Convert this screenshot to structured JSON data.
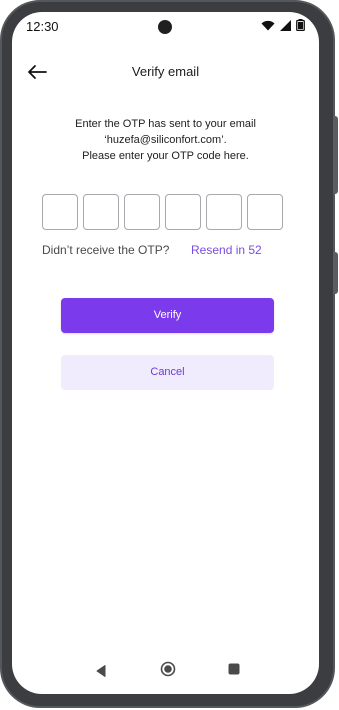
{
  "status_bar": {
    "time": "12:30"
  },
  "header": {
    "title": "Verify email"
  },
  "description": {
    "line1": "Enter the OTP has sent to your email",
    "line2": "‘huzefa@siliconfort.com’.",
    "line3": "Please enter your OTP code here."
  },
  "otp": {
    "digits": [
      "",
      "",
      "",
      "",
      "",
      ""
    ]
  },
  "resend": {
    "question": "Didn’t receive the OTP?",
    "action": "Resend in 52"
  },
  "buttons": {
    "verify": "Verify",
    "cancel": "Cancel"
  },
  "colors": {
    "accent": "#7c3aed",
    "cancel_bg": "#f1ecfd",
    "resend_link": "#7b4ce0"
  },
  "icons": [
    "wifi-icon",
    "signal-icon",
    "battery-icon",
    "back-arrow-icon",
    "nav-back-icon",
    "nav-home-icon",
    "nav-recent-icon"
  ]
}
